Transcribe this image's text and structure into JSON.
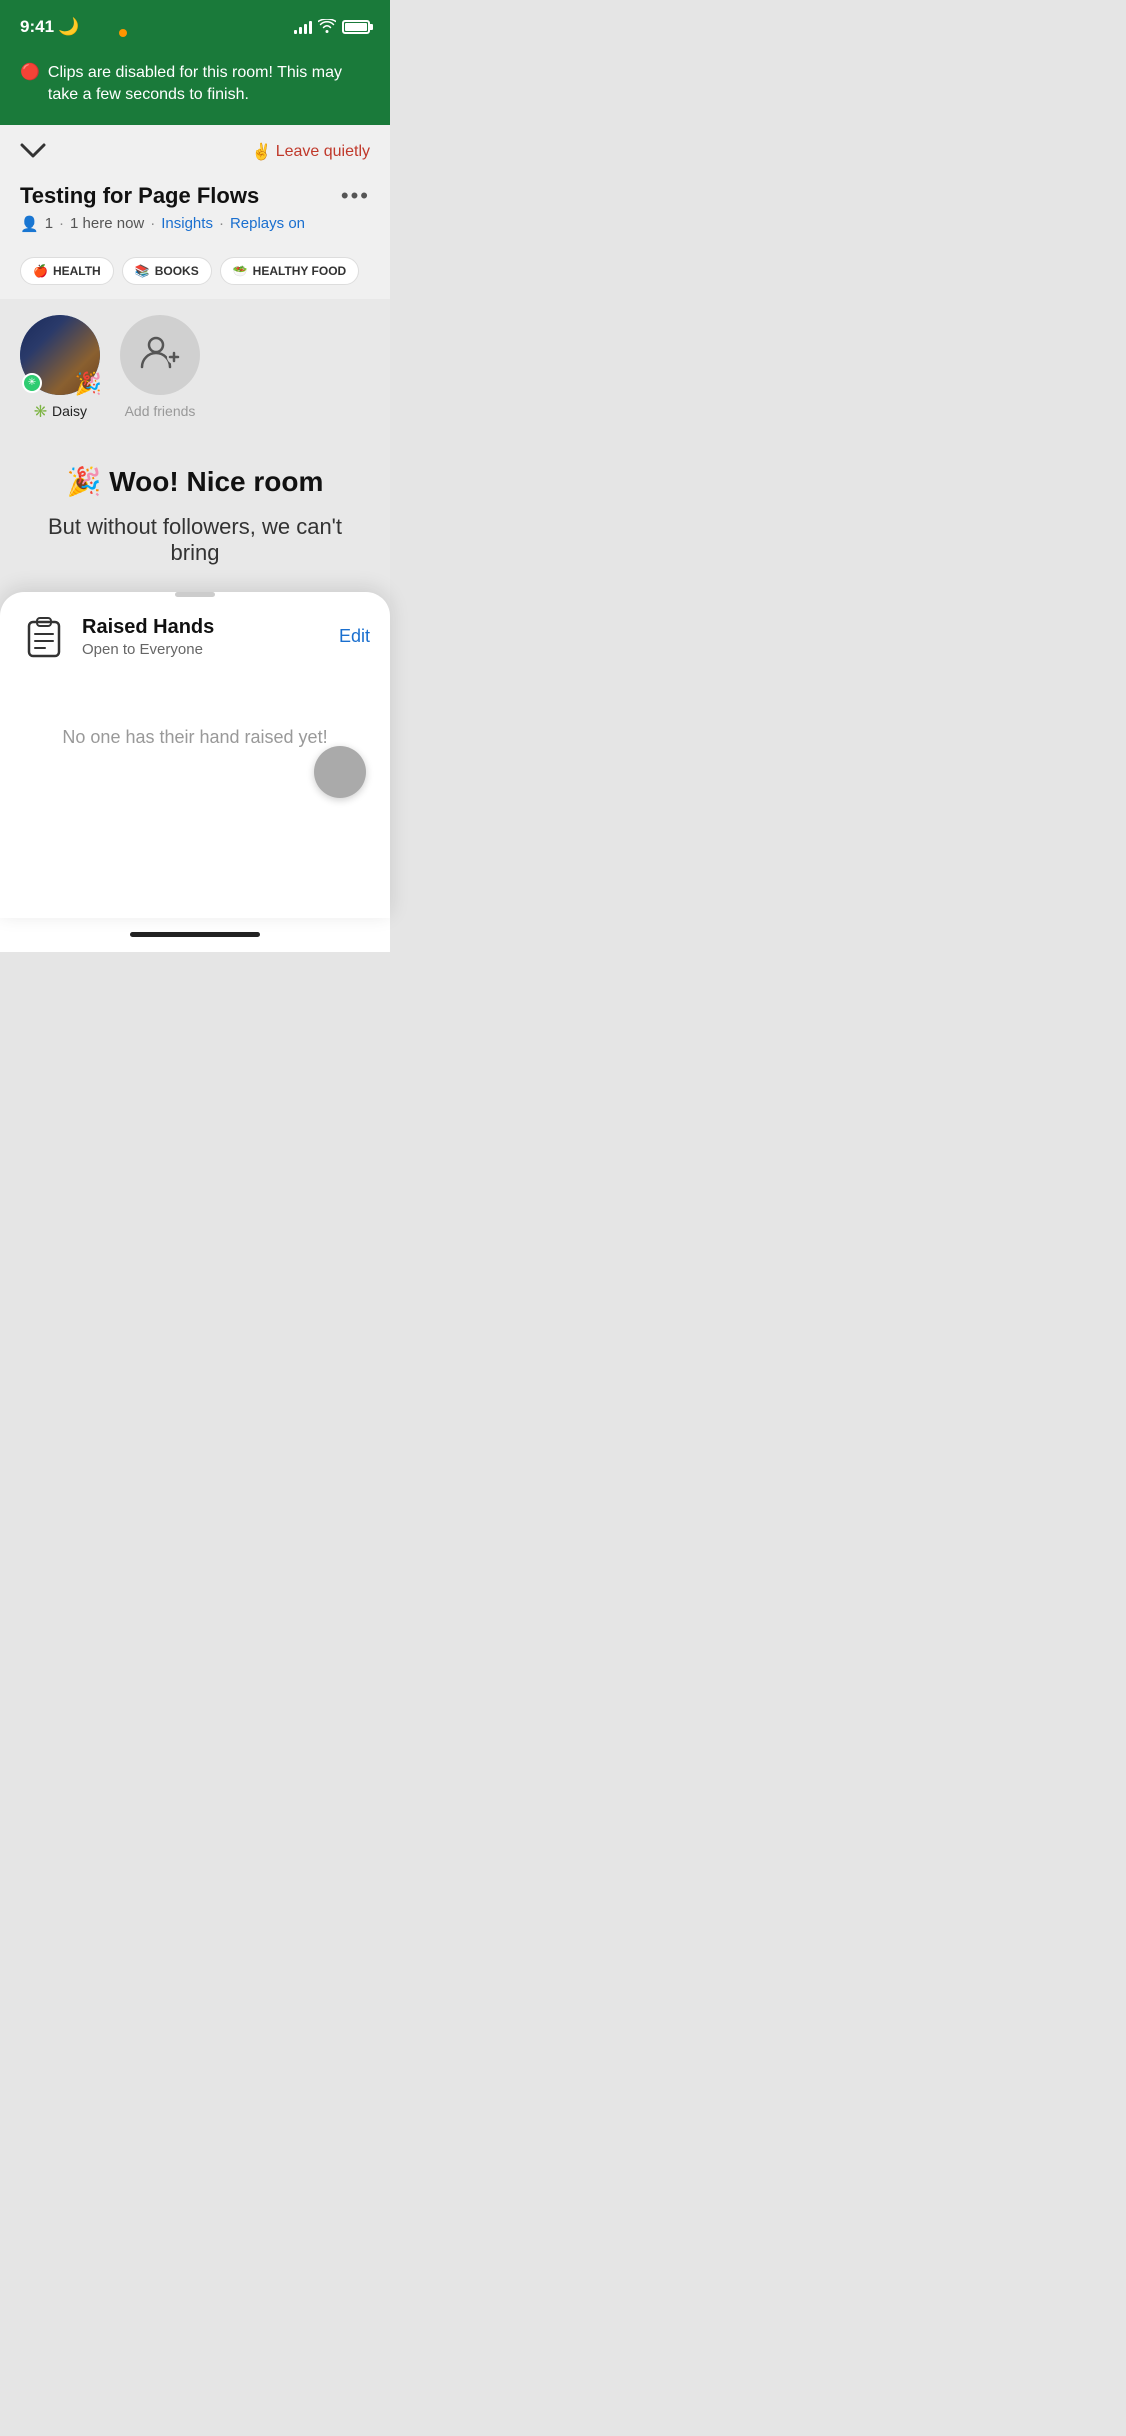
{
  "statusBar": {
    "time": "9:41",
    "moonIcon": "🌙",
    "orangeDot": true
  },
  "banner": {
    "icon": "🔴",
    "text": "Clips are disabled for this room! This may take a few seconds to finish."
  },
  "topNav": {
    "chevron": "∨",
    "leaveEmoji": "✌️",
    "leaveLabel": "Leave quietly"
  },
  "room": {
    "title": "Testing for Page Flows",
    "moreLabel": "•••",
    "memberCount": "1",
    "hereNow": "1 here now",
    "insightsLabel": "Insights",
    "replaysLabel": "Replays on"
  },
  "tags": [
    {
      "emoji": "🍎",
      "label": "HEALTH"
    },
    {
      "emoji": "📚",
      "label": "BOOKS"
    },
    {
      "emoji": "🥗",
      "label": "HEALTHY FOOD"
    }
  ],
  "participants": [
    {
      "name": "Daisy",
      "hasBadge": true,
      "badgeEmoji": "✳️",
      "partyHat": "🎉"
    }
  ],
  "addFriends": {
    "label": "Add friends"
  },
  "celebration": {
    "emoji": "🎉",
    "heading": "Woo! Nice room",
    "subtext": "But without followers, we can't bring"
  },
  "bottomSheet": {
    "handleVisible": true,
    "title": "Raised Hands",
    "subtitle": "Open to Everyone",
    "editLabel": "Edit",
    "emptyState": "No one has their hand raised yet!"
  }
}
